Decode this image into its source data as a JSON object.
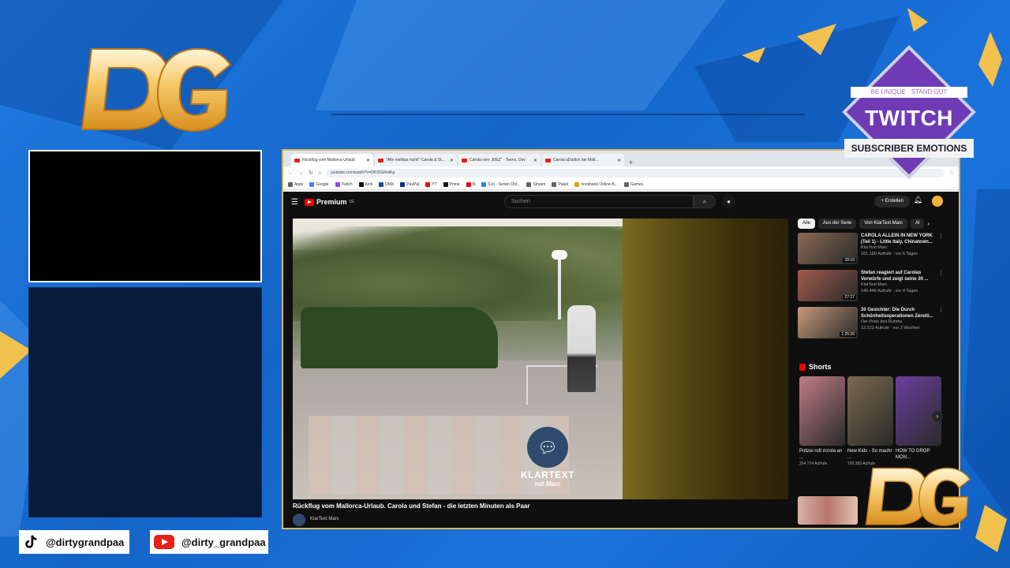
{
  "overlay": {
    "tiktok_handle": "@dirtygrandpaa",
    "youtube_handle": "@dirty_grandpaa",
    "twitch_badge": {
      "top_text": "BE UNIQUE · STAND OUT",
      "word": "TWITCH",
      "bottom_text": "SUBSCRIBER EMOTIONS"
    },
    "colors": {
      "background": "#1b6fd6",
      "gold": "#f2c14e",
      "twitch_purple": "#6f3bb4"
    }
  },
  "browser": {
    "tabs": [
      {
        "label": "Rückflug vom Mallorca-Urlaub"
      },
      {
        "label": "\"Alle meiklas nicht!\" Carola & St..."
      },
      {
        "label": "Carola vom „KIEZ\" - Teens, Dev"
      },
      {
        "label": "Carola aDüdich bei Mall..."
      }
    ],
    "new_tab": "+",
    "url": "youtube.com/watch?v=DKIDGIhvlKg",
    "bookmarks": [
      {
        "label": "Apps",
        "color": "#5f6368"
      },
      {
        "label": "Google",
        "color": "#4285f4"
      },
      {
        "label": "Twitch",
        "color": "#9146ff"
      },
      {
        "label": "Kick",
        "color": "#111111"
      },
      {
        "label": "DMX",
        "color": "#1a4f9c"
      },
      {
        "label": "PayPal",
        "color": "#003087"
      },
      {
        "label": "YT",
        "color": "#ff0000"
      },
      {
        "label": "Prime",
        "color": "#111111"
      },
      {
        "label": "N",
        "color": "#e50914"
      },
      {
        "label": "S.to - Serien Onl...",
        "color": "#1e88e5"
      },
      {
        "label": "Stream",
        "color": "#5f6368"
      },
      {
        "label": "Paket",
        "color": "#5f6368"
      },
      {
        "label": "norisbank Online-B...",
        "color": "#e0a000"
      },
      {
        "label": "Games",
        "color": "#5f6368"
      }
    ]
  },
  "youtube": {
    "logo_text": "Premium",
    "logo_sup": "DE",
    "search_placeholder": "Suchen",
    "create_label": "Erstellen",
    "video_title": "Rückflug vom Mallorca-Urlaub. Carola und Stefan - die letzten Minuten als Paar",
    "channel": "KlarText Marc",
    "player_brand": "KLARTEXT",
    "player_brand_sub": "mit Marc",
    "chips": [
      "Alle",
      "Aus der Serie",
      "Von KlarText Marc",
      "Al"
    ],
    "recommendations": [
      {
        "title": "CAROLA ALLEIN IN NEW YORK (Teil 1) - Little Italy, Chinatown...",
        "channel": "KlarText Marc",
        "stats": "161.180 Aufrufe · vor 5 Tagen",
        "duration": "28:10",
        "color": "#8a6a55"
      },
      {
        "title": "Stefan reagiert auf Carolas Vorwürfe und zeigt seine 30 ...",
        "channel": "KlarText Marc",
        "stats": "140.446 Aufrufe · vor 4 Tagen",
        "duration": "27:27",
        "color": "#a25b4c"
      },
      {
        "title": "30 Gesichter: Die Durch Schönheitsoperationen Zerstö...",
        "channel": "Der Preis des Ruhms",
        "stats": "13.222 Aufrufe · vor 2 Wochen",
        "duration": "1:25:26",
        "color": "#c79a7a"
      }
    ],
    "shorts_title": "Shorts",
    "shorts": [
      {
        "title": "Polizei ruft #crola an ...",
        "views": "254.774 Aufrufe",
        "color": "#c07d86"
      },
      {
        "title": "New Kids - So macht ...",
        "views": "700.365 Aufrufe",
        "color": "#7a6a4d"
      },
      {
        "title": "HOW TO DROP MON...",
        "views": "",
        "color": "#6b3fa0"
      }
    ]
  }
}
